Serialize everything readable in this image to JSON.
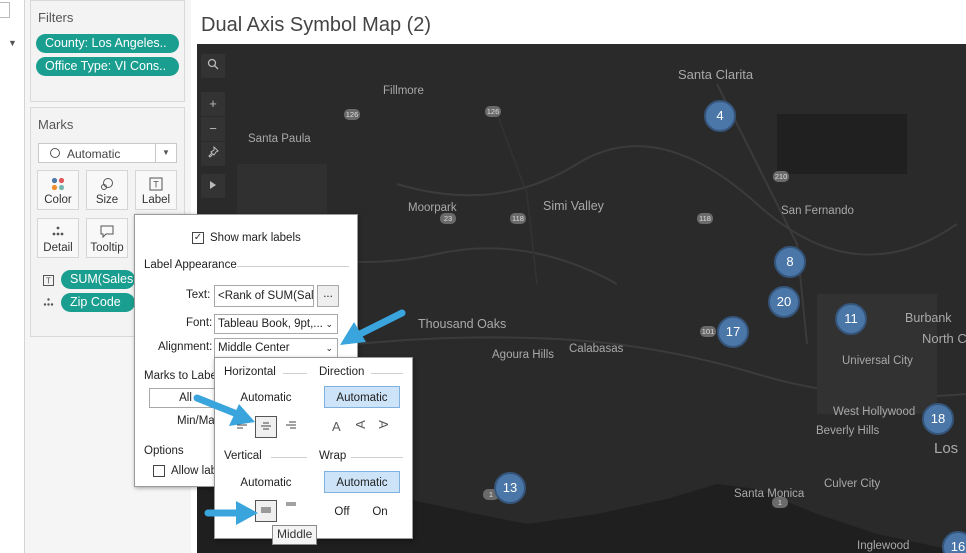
{
  "sidebar": {
    "filters_title": "Filters",
    "filter_pills": [
      "County: Los Angeles..",
      "Office Type: VI Cons.."
    ],
    "marks_title": "Marks",
    "mark_type": "Automatic",
    "mark_buttons": [
      "Color",
      "Size",
      "Label",
      "Detail",
      "Tooltip"
    ],
    "mark_fields": [
      "SUM(Sales",
      "Zip Code"
    ]
  },
  "view": {
    "title": "Dual Axis Symbol Map (2)"
  },
  "map": {
    "places": [
      "Santa Clarita",
      "Fillmore",
      "Santa Paula",
      "Moorpark",
      "Simi Valley",
      "San Fernando",
      "Thousand Oaks",
      "Agoura Hills",
      "Calabasas",
      "Burbank",
      "North C",
      "Universal City",
      "West Hollywood",
      "Beverly Hills",
      "Los",
      "Santa Monica",
      "Culver City",
      "Inglewood"
    ],
    "highways": [
      "126",
      "126",
      "23",
      "118",
      "118",
      "210",
      "101",
      "1",
      "1"
    ],
    "bubbles": [
      "4",
      "8",
      "20",
      "17",
      "11",
      "18",
      "13",
      "16"
    ],
    "bubble_color": "#4a77a8",
    "background_color": "#2a2a2a"
  },
  "label_dialog": {
    "show_mark_labels": "Show mark labels",
    "section_label_appearance": "Label Appearance",
    "text_label": "Text:",
    "text_value": "<Rank of SUM(Sale",
    "text_button": "...",
    "font_label": "Font:",
    "font_value": "Tableau Book, 9pt,...",
    "alignment_label": "Alignment:",
    "alignment_value": "Middle Center",
    "marks_to_label": "Marks to Label",
    "all_button": "All",
    "minmax": "Min/Max",
    "options": "Options",
    "allow_labels": "Allow lab"
  },
  "alignment_popup": {
    "horizontal": "Horizontal",
    "direction": "Direction",
    "automatic": "Automatic",
    "vertical": "Vertical",
    "wrap": "Wrap",
    "off": "Off",
    "on": "On",
    "tooltip": "Middle",
    "accent_color": "#cde3f7"
  }
}
